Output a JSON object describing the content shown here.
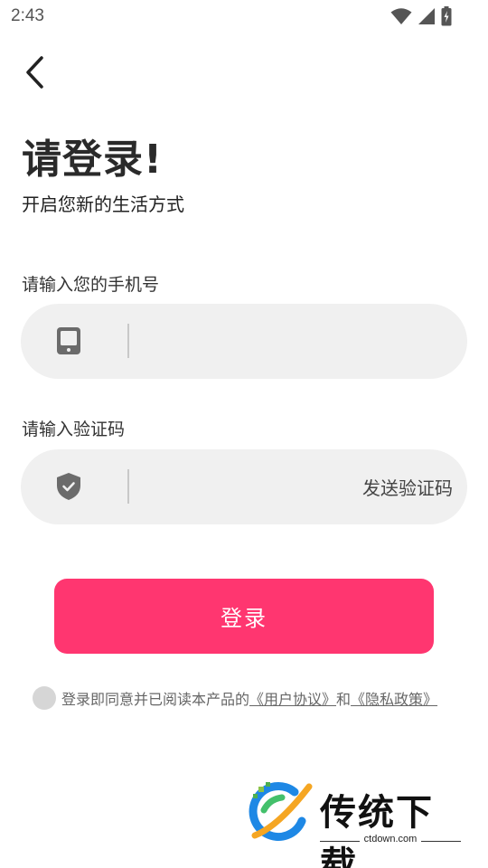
{
  "status_bar": {
    "time": "2:43"
  },
  "page": {
    "title": "请登录!",
    "subtitle": "开启您新的生活方式"
  },
  "phone_field": {
    "label": "请输入您的手机号",
    "value": "",
    "placeholder": ""
  },
  "code_field": {
    "label": "请输入验证码",
    "value": "",
    "placeholder": "",
    "send_code_label": "发送验证码"
  },
  "login_button": {
    "label": "登录"
  },
  "agreement": {
    "prefix": "登录即同意并已阅读本产品的",
    "user_agreement": "《用户协议》",
    "conjunction": "和",
    "privacy_policy": "《隐私政策》"
  },
  "watermark": {
    "brand": "传统下载",
    "domain": "ctdown.com"
  },
  "colors": {
    "accent": "#ff3670",
    "field_bg": "#f0f0f0",
    "icon_gray": "#6b6b6b"
  },
  "icons": [
    "wifi-icon",
    "signal-icon",
    "battery-icon",
    "back-arrow-icon",
    "phone-icon",
    "shield-check-icon"
  ]
}
